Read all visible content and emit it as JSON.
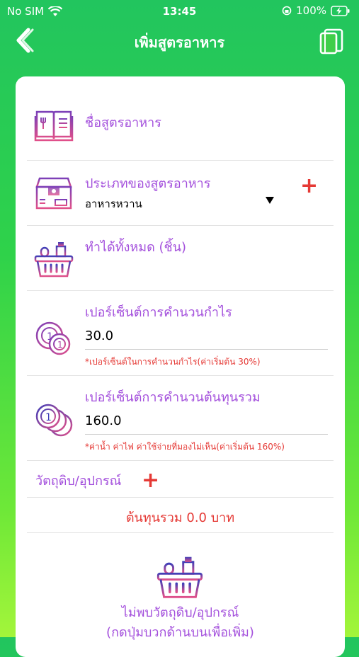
{
  "status_bar": {
    "carrier": "No SIM",
    "time": "13:45",
    "battery": "100%"
  },
  "nav": {
    "title": "เพิ่มสูตรอาหาร",
    "back_icon": "chevron-left-icon",
    "copy_icon": "copy-icon"
  },
  "form": {
    "recipe_name": {
      "label": "ชื่อสูตรอาหาร"
    },
    "category": {
      "label": "ประเภทของสูตรอาหาร",
      "selected": "อาหารหวาน"
    },
    "yield": {
      "label": "ทำได้ทั้งหมด (ชิ้น)"
    },
    "profit": {
      "label": "เปอร์เซ็นต์การคำนวนกำไร",
      "value": "30.0",
      "hint": "*เปอร์เซ็นต์ในการคำนวนกำไร(ค่าเริ่มต้น 30%)"
    },
    "total_cost_pct": {
      "label": "เปอร์เซ็นต์การคำนวนต้นทุนรวม",
      "value": "160.0",
      "hint": "*ค่าน้ำ ค่าไฟ ค่าใช้จ่ายที่มองไม่เห็น(ค่าเริ่มต้น 160%)"
    },
    "ingredients": {
      "label": "วัตถุดิบ/อุปกรณ์"
    },
    "total_cost": "ต้นทุนรวม 0.0 บาท",
    "empty_line1": "ไม่พบวัตถุดิบ/อุปกรณ์",
    "empty_line2": "(กดปุ่มบวกด้านบนเพื่อเพิ่ม)"
  },
  "colors": {
    "accent_purple": "#a34fdc",
    "accent_red": "#e53935",
    "green_top": "#22c55e",
    "green_bottom": "#a3f53a"
  }
}
